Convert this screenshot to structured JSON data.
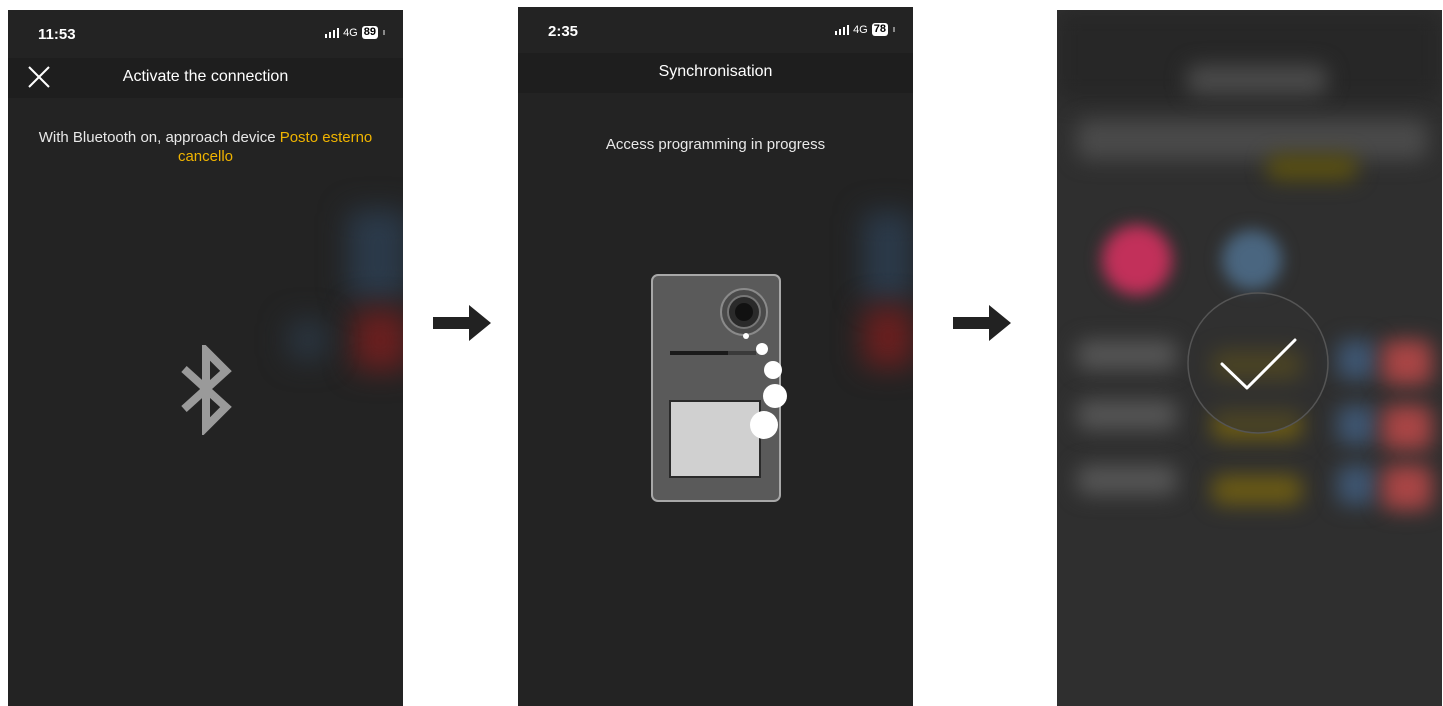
{
  "screen1": {
    "status": {
      "time": "11:53",
      "network": "4G",
      "battery": "89"
    },
    "title": "Activate the connection",
    "message_prefix": "With Bluetooth on, approach device ",
    "device_name": "Posto esterno cancello"
  },
  "screen2": {
    "status": {
      "time": "2:35",
      "network": "4G",
      "battery": "78"
    },
    "title": "Synchronisation",
    "message": "Access programming in progress"
  },
  "screen3": {
    "icons": [
      "checkmark-icon"
    ]
  },
  "flow_arrows": [
    "right-arrow-icon",
    "right-arrow-icon"
  ],
  "colors": {
    "accent": "#f0b400",
    "background": "#232323",
    "navbar": "#1e1e1e"
  }
}
